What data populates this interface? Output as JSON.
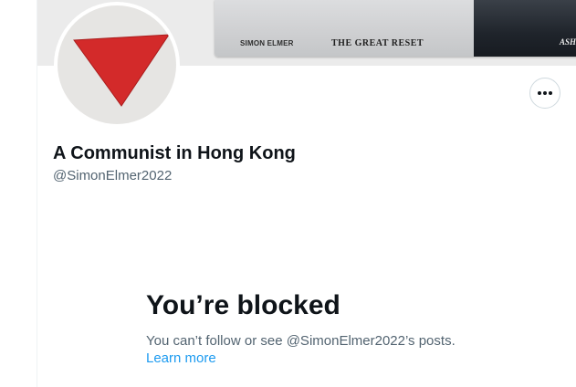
{
  "banner": {
    "book_author": "SIMON ELMER",
    "book_title": "THE GREAT RESET",
    "book_publisher": "ASH"
  },
  "profile": {
    "display_name": "A Communist in Hong Kong",
    "handle": "@SimonElmer2022"
  },
  "blocked": {
    "title": "You’re blocked",
    "description": "You can’t follow or see @SimonElmer2022’s posts.",
    "learn_more": "Learn more"
  },
  "icons": {
    "more": "more-dots-icon",
    "avatar": "red-triangle-icon"
  },
  "colors": {
    "text_primary": "#0f1419",
    "text_secondary": "#536471",
    "link": "#1d9bf0",
    "avatar_triangle": "#d32a2a"
  }
}
